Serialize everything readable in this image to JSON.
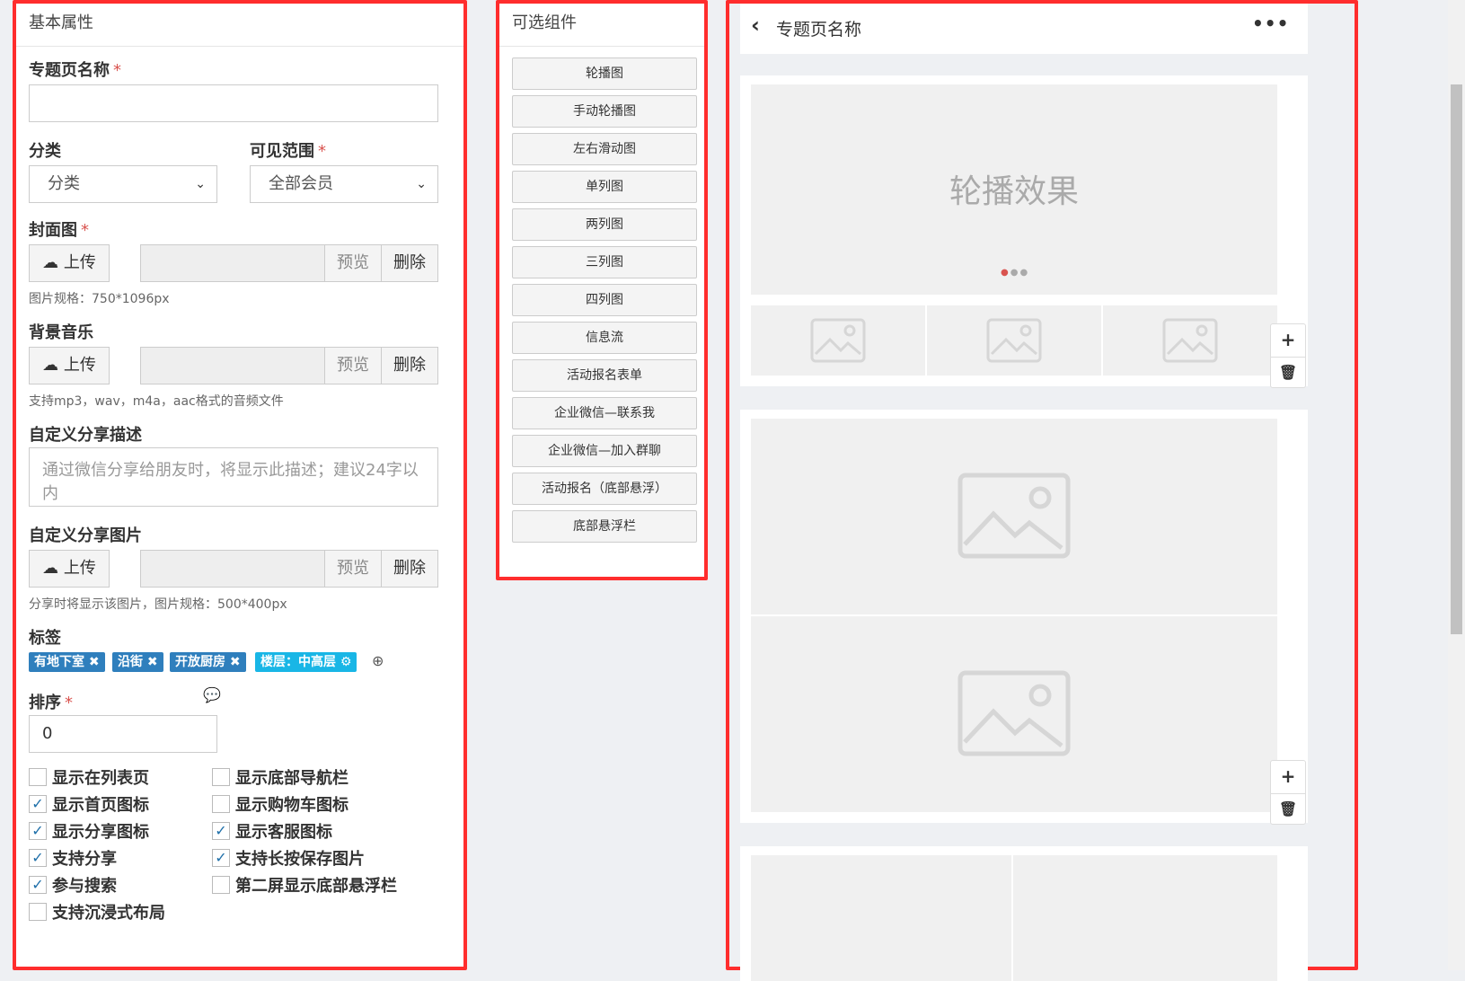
{
  "left_panel": {
    "title": "基本属性",
    "page_name_label": "专题页名称",
    "required_mark": "*",
    "category_label": "分类",
    "category_value": "分类",
    "visibility_label": "可见范围",
    "visibility_value": "全部会员",
    "cover_label": "封面图",
    "upload_label": "上传",
    "preview_label": "预览",
    "delete_label": "删除",
    "cover_hint": "图片规格：750*1096px",
    "music_label": "背景音乐",
    "music_hint": "支持mp3，wav，m4a，aac格式的音频文件",
    "share_desc_label": "自定义分享描述",
    "share_desc_placeholder": "通过微信分享给朋友时，将显示此描述；建议24字以内",
    "share_image_label": "自定义分享图片",
    "share_image_hint": "分享时将显示该图片，图片规格：500*400px",
    "tags_label": "标签",
    "tags": [
      "有地下室 ✖",
      "沿街 ✖",
      "开放厨房 ✖",
      "楼层：中高层 ⚙"
    ],
    "sort_label": "排序",
    "sort_value": "0",
    "checkboxes_left": [
      {
        "label": "显示在列表页",
        "checked": false
      },
      {
        "label": "显示首页图标",
        "checked": true
      },
      {
        "label": "显示分享图标",
        "checked": true
      },
      {
        "label": "支持分享",
        "checked": true
      },
      {
        "label": "参与搜索",
        "checked": true
      },
      {
        "label": "支持沉浸式布局",
        "checked": false
      }
    ],
    "checkboxes_right": [
      {
        "label": "显示底部导航栏",
        "checked": false
      },
      {
        "label": "显示购物车图标",
        "checked": false
      },
      {
        "label": "显示客服图标",
        "checked": true
      },
      {
        "label": "支持长按保存图片",
        "checked": true
      },
      {
        "label": "第二屏显示底部悬浮栏",
        "checked": false
      }
    ]
  },
  "mid_panel": {
    "title": "可选组件",
    "components": [
      "轮播图",
      "手动轮播图",
      "左右滑动图",
      "单列图",
      "两列图",
      "三列图",
      "四列图",
      "信息流",
      "活动报名表单",
      "企业微信—联系我",
      "企业微信—加入群聊",
      "活动报名（底部悬浮）",
      "底部悬浮栏"
    ]
  },
  "preview": {
    "page_title": "专题页名称",
    "carousel_text": "轮播效果",
    "more_icon": "more-dots-icon"
  },
  "colors": {
    "frame_red": "#ff2d2d",
    "tag_blue": "#2f7fbd",
    "tag_cyan": "#19b6e6",
    "check_blue": "#1e6fa9"
  }
}
